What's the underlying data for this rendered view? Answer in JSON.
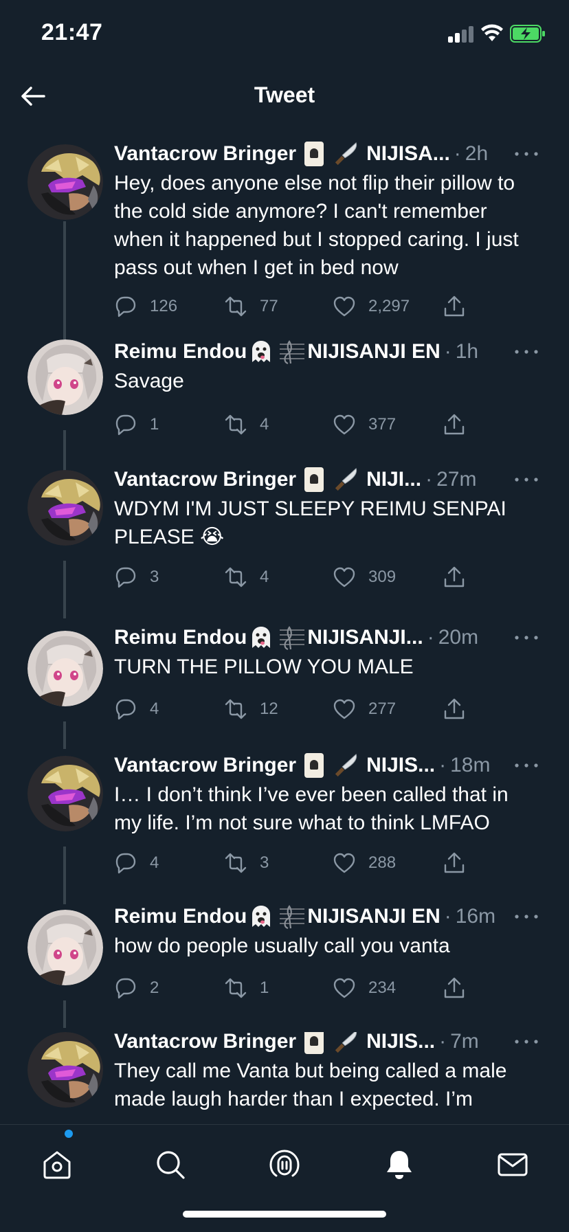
{
  "status": {
    "time": "21:47"
  },
  "header": {
    "title": "Tweet",
    "back_icon": "arrow-left-icon"
  },
  "colors": {
    "background": "#15202b",
    "secondary_text": "#8b98a5",
    "accent": "#1d9bf0",
    "thread_line": "#38444d"
  },
  "tweets": [
    {
      "author": "Vantacrow Bringer",
      "badge": "NIJISA...",
      "time": "2h",
      "text": "Hey, does anyone else not flip their pillow to the cold side anymore? I can't remember when it happened but I stopped caring. I just pass out when I get in bed now",
      "replies": "126",
      "retweets": "77",
      "likes": "2,297"
    },
    {
      "author": "Reimu Endou",
      "badge": "NIJISANJI EN",
      "time": "1h",
      "text": "Savage",
      "replies": "1",
      "retweets": "4",
      "likes": "377"
    },
    {
      "author": "Vantacrow Bringer",
      "badge": "NIJI...",
      "time": "27m",
      "text": "WDYM I'M JUST SLEEPY REIMU SENPAI PLEASE 😭",
      "replies": "3",
      "retweets": "4",
      "likes": "309"
    },
    {
      "author": "Reimu Endou",
      "badge": "NIJISANJI...",
      "time": "20m",
      "text": "TURN THE PILLOW YOU MALE",
      "replies": "4",
      "retweets": "12",
      "likes": "277"
    },
    {
      "author": "Vantacrow Bringer",
      "badge": "NIJIS...",
      "time": "18m",
      "text": "I… I don’t think I’ve ever been called that in my life. I’m not sure what to think LMFAO",
      "replies": "4",
      "retweets": "3",
      "likes": "288"
    },
    {
      "author": "Reimu Endou",
      "badge": "NIJISANJI EN",
      "time": "16m",
      "text": "how do people usually call you vanta",
      "replies": "2",
      "retweets": "1",
      "likes": "234"
    },
    {
      "author": "Vantacrow Bringer",
      "badge": "NIJIS...",
      "time": "7m",
      "text": "They call me Vanta but being called a male made laugh harder than I expected. I’m",
      "replies": "",
      "retweets": "",
      "likes": ""
    }
  ],
  "tabbar": {
    "tabs": [
      "home-icon",
      "search-icon",
      "spaces-icon",
      "notifications-icon",
      "messages-icon"
    ]
  }
}
